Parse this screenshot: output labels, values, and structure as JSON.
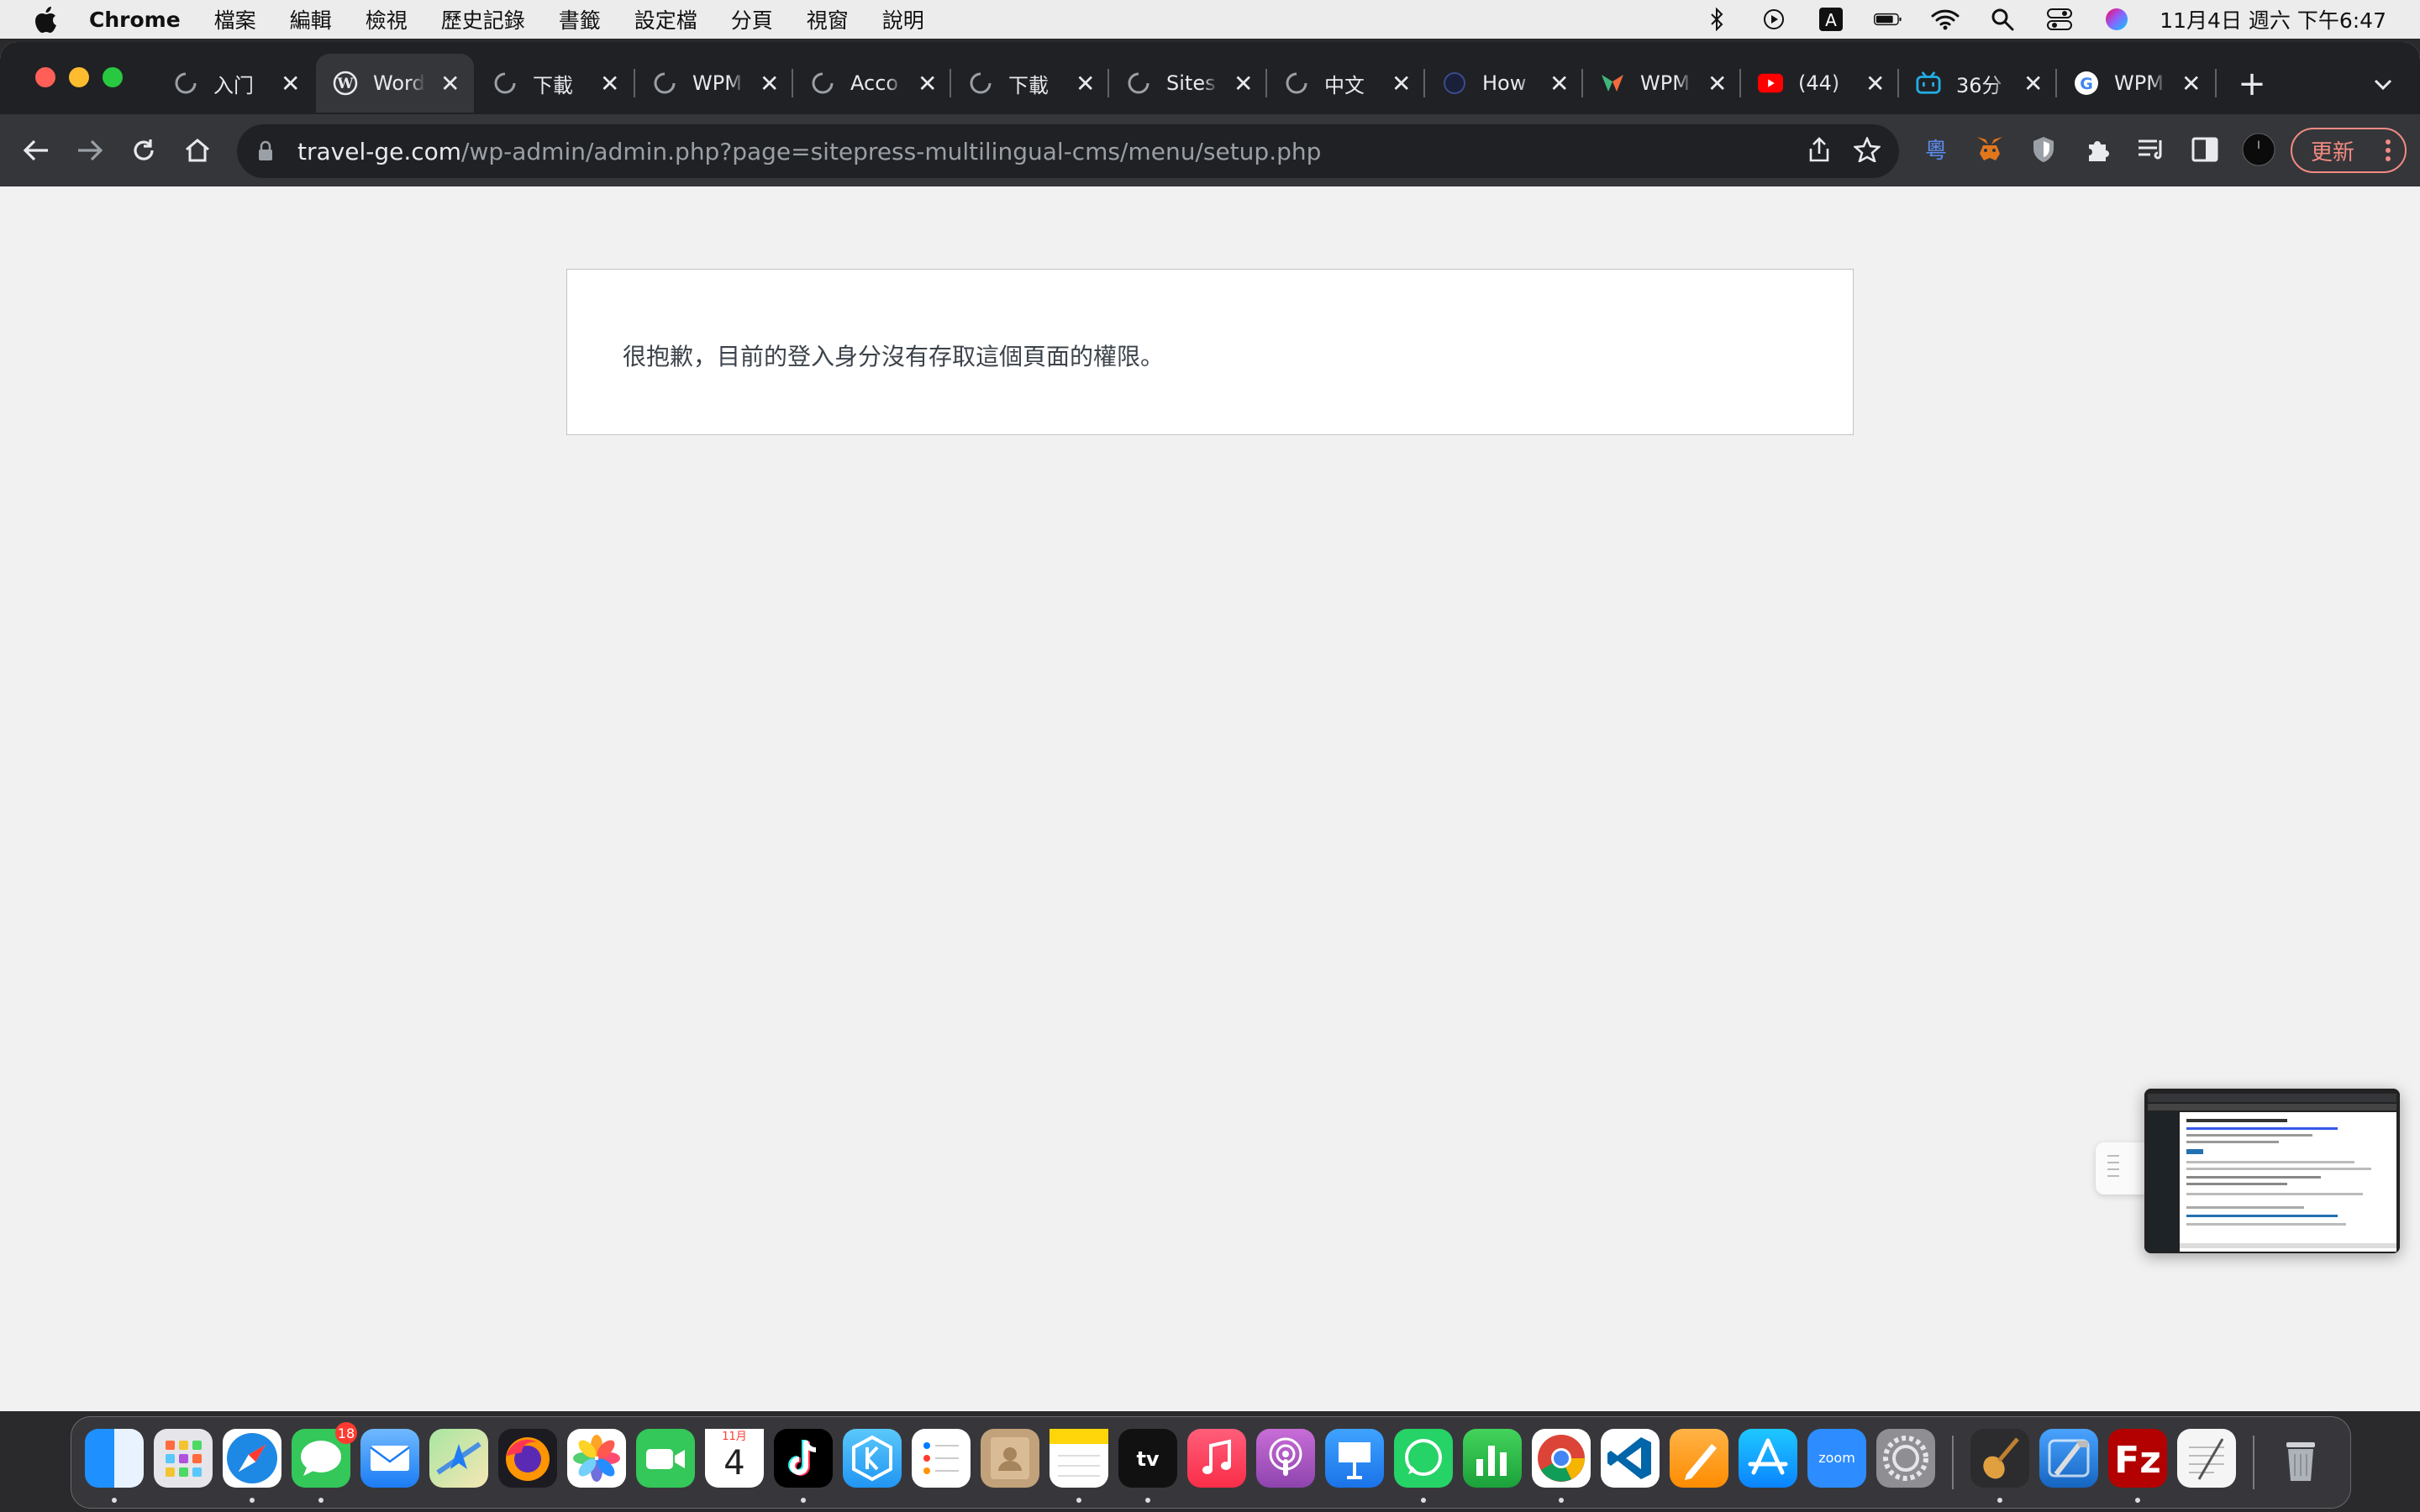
{
  "menubar": {
    "app_name": "Chrome",
    "menus": [
      "檔案",
      "編輯",
      "檢視",
      "歷史記錄",
      "書籤",
      "設定檔",
      "分頁",
      "視窗",
      "說明"
    ],
    "clock": "11月4日 週六 下午6:47"
  },
  "tabs": [
    {
      "title": "入门",
      "icon": "loading-icon"
    },
    {
      "title": "Word",
      "icon": "wordpress-icon",
      "active": true
    },
    {
      "title": "下載",
      "icon": "loading-icon"
    },
    {
      "title": "WPM",
      "icon": "loading-icon"
    },
    {
      "title": "Acco",
      "icon": "loading-icon"
    },
    {
      "title": "下載",
      "icon": "loading-icon"
    },
    {
      "title": "Sites",
      "icon": "loading-icon"
    },
    {
      "title": "中文",
      "icon": "loading-icon"
    },
    {
      "title": "How",
      "icon": "site-icon"
    },
    {
      "title": "WPM",
      "icon": "wpml-icon"
    },
    {
      "title": "(44)",
      "icon": "youtube-icon"
    },
    {
      "title": "36分",
      "icon": "bilibili-icon"
    },
    {
      "title": "WPM",
      "icon": "google-icon"
    }
  ],
  "address_bar": {
    "host": "travel-ge.com",
    "path": "/wp-admin/admin.php?page=sitepress-multilingual-cms/menu/setup.php"
  },
  "toolbar": {
    "update_label": "更新"
  },
  "page": {
    "error_message": "很抱歉，目前的登入身分沒有存取這個頁面的權限。"
  },
  "dock": {
    "messages_badge": "18",
    "calendar_month": "11月",
    "calendar_day": "4",
    "zoom_label": "zoom",
    "tv_label": "tv"
  },
  "colors": {
    "accent_update": "#f28b82",
    "page_bg": "#f1f1f1",
    "tab_bg": "#202124",
    "toolbar_bg": "#35363a"
  }
}
